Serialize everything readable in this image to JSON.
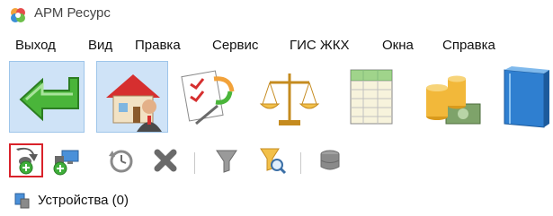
{
  "window": {
    "title": "АРМ Ресурс",
    "app_icon": "app-logo-icon"
  },
  "menu": {
    "items": [
      {
        "label": "Выход"
      },
      {
        "label": "Вид"
      },
      {
        "label": "Правка"
      },
      {
        "label": "Сервис"
      },
      {
        "label": "ГИС ЖКХ"
      },
      {
        "label": "Окна"
      },
      {
        "label": "Справка"
      }
    ]
  },
  "big_toolbar": {
    "buttons": [
      {
        "icon": "back-arrow-icon",
        "selected": true
      },
      {
        "icon": "house-person-icon",
        "selected": true
      },
      {
        "icon": "document-sync-icon",
        "selected": false
      },
      {
        "icon": "scales-icon",
        "selected": false
      },
      {
        "icon": "spreadsheet-icon",
        "selected": false
      },
      {
        "icon": "coins-money-icon",
        "selected": false
      },
      {
        "icon": "blue-book-icon",
        "selected": false
      }
    ]
  },
  "small_toolbar": {
    "buttons": [
      {
        "icon": "add-device-icon",
        "active": true
      },
      {
        "icon": "add-network-icon",
        "active": false
      },
      {
        "icon": "refresh-clock-icon",
        "active": false
      },
      {
        "icon": "delete-x-icon",
        "active": false
      },
      {
        "icon": "filter-funnel-icon",
        "active": false
      },
      {
        "icon": "filter-search-icon",
        "active": false
      },
      {
        "icon": "database-icon",
        "active": false
      }
    ]
  },
  "tab": {
    "label": "Устройства (0)",
    "icon": "device-tab-icon"
  },
  "colors": {
    "selected_bg": "#cfe3f7",
    "active_border": "#d9222a"
  }
}
